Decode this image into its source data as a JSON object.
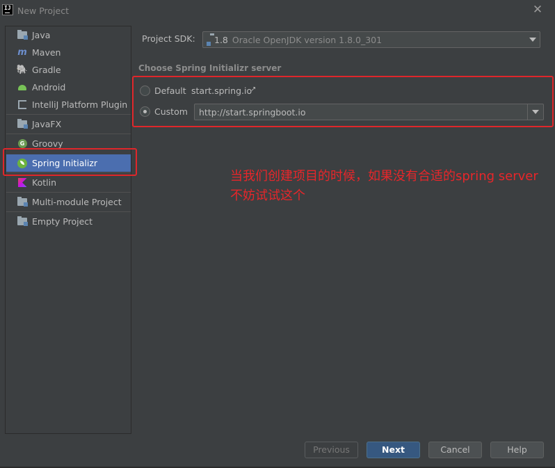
{
  "window": {
    "title": "New Project",
    "logo_text": "IJ"
  },
  "sidebar": {
    "items": [
      {
        "label": "Java",
        "icon": "folder-icon"
      },
      {
        "label": "Maven",
        "icon": "maven-icon"
      },
      {
        "label": "Gradle",
        "icon": "gradle-icon"
      },
      {
        "label": "Android",
        "icon": "android-icon"
      },
      {
        "label": "IntelliJ Platform Plugin",
        "icon": "intellij-plugin-icon"
      },
      {
        "label": "JavaFX",
        "icon": "folder-icon"
      },
      {
        "label": "Groovy",
        "icon": "groovy-icon",
        "icon_text": "G"
      },
      {
        "label": "Spring Initializr",
        "icon": "spring-icon",
        "selected": true
      },
      {
        "label": "Kotlin",
        "icon": "kotlin-icon"
      },
      {
        "label": "Multi-module Project",
        "icon": "folder-icon"
      },
      {
        "label": "Empty Project",
        "icon": "folder-icon"
      }
    ]
  },
  "sdk": {
    "label": "Project SDK:",
    "version": "1.8",
    "name": "Oracle OpenJDK version 1.8.0_301"
  },
  "server": {
    "section_title": "Choose Spring Initializr server",
    "default_label": "Default",
    "default_url": "start.spring.io",
    "external_link_glyph": "↗",
    "custom_label": "Custom",
    "custom_url": "http://start.springboot.io",
    "selected": "custom"
  },
  "annotation": {
    "text": "当我们创建项目的时候，如果没有合适的spring server 不妨试试这个"
  },
  "buttons": {
    "previous": "Previous",
    "next": "Next",
    "cancel": "Cancel",
    "help": "Help"
  },
  "colors": {
    "accent": "#4b6eaf",
    "annotation": "#e0262a",
    "background": "#3c3f41"
  }
}
